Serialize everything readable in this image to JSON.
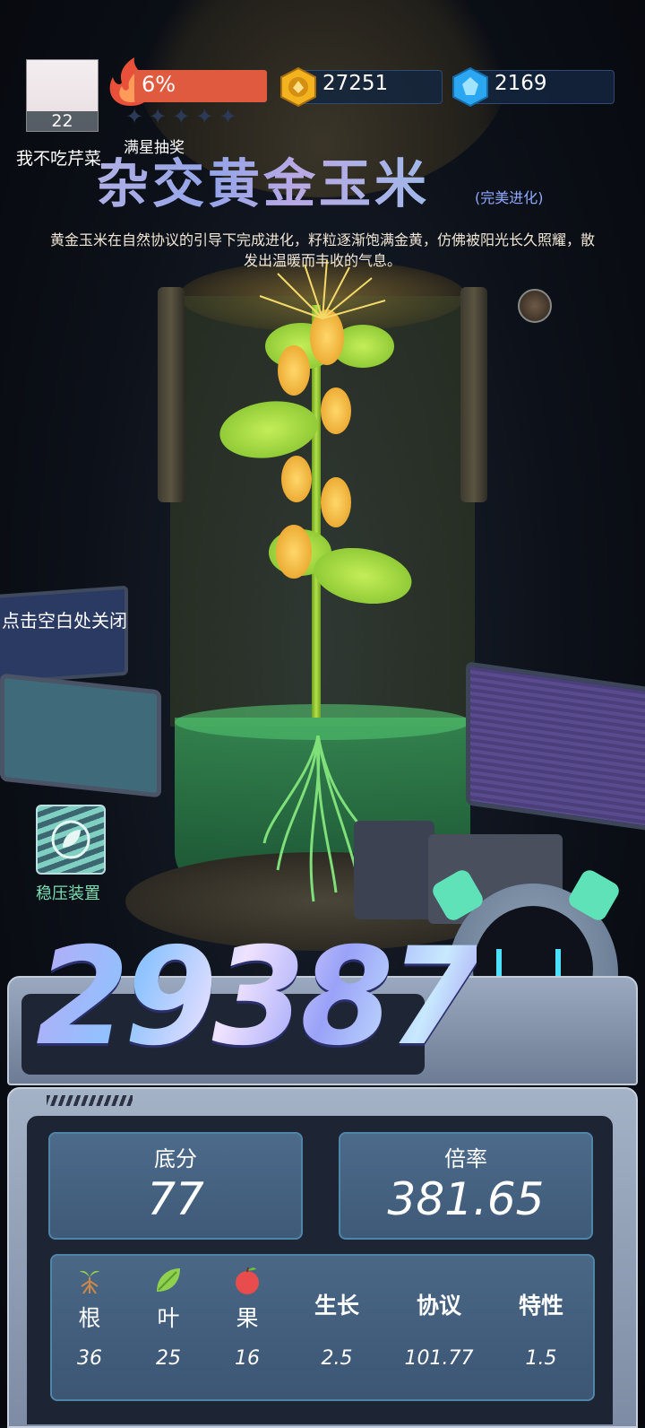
{
  "hud": {
    "player_level": "22",
    "fire_percent": "6%",
    "coins": "27251",
    "gems": "2169",
    "nickname": "我不吃芹菜",
    "lottery_label": "满星抽奖",
    "stars_filled": 0,
    "stars_total": 5
  },
  "plant": {
    "name": "杂交黄金玉米",
    "evolution_tag": "(完美进化)",
    "description": "黄金玉米在自然协议的引导下完成进化，籽粒逐渐饱满金黄，仿佛被阳光长久照耀，散发出温暖而丰收的气息。"
  },
  "close_hint": "点击空白处关闭",
  "stabilizer": {
    "label": "稳压装置"
  },
  "score": {
    "total": "29387",
    "base_label": "底分",
    "base_value": "77",
    "multiplier_label": "倍率",
    "multiplier_value": "381.65"
  },
  "attributes": [
    {
      "name": "根",
      "icon": "root-icon",
      "value": "36"
    },
    {
      "name": "叶",
      "icon": "leaf-icon",
      "value": "25"
    },
    {
      "name": "果",
      "icon": "fruit-icon",
      "value": "16"
    },
    {
      "name": "生长",
      "value": "2.5"
    },
    {
      "name": "协议",
      "value": "101.77"
    },
    {
      "name": "特性",
      "value": "1.5"
    }
  ],
  "colors": {
    "fire_bar": "#e05a40",
    "stabilizer_label": "#79e0b4",
    "evolution_tag": "#8fa9ff",
    "panel_card": "#4c6a8a"
  }
}
